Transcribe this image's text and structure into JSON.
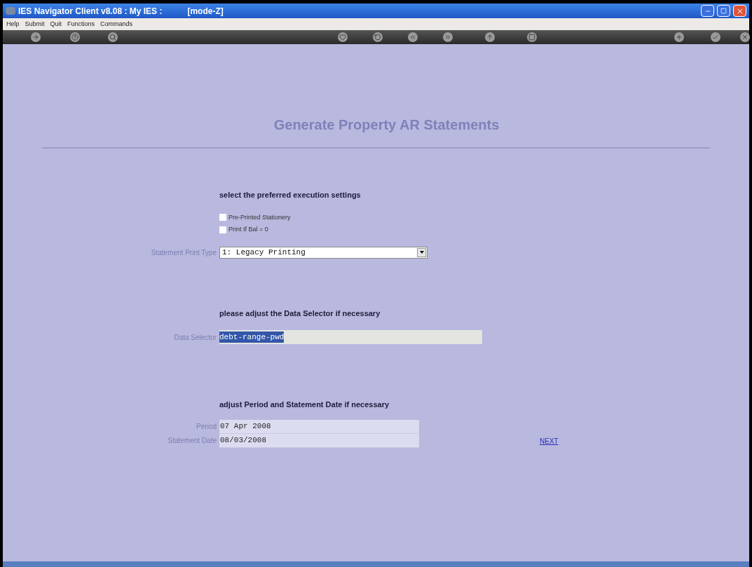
{
  "window": {
    "title": "IES Navigator Client v8.08 : My IES :",
    "mode": "[mode-Z]"
  },
  "menu": [
    "Help",
    "Submit",
    "Quit",
    "Functions",
    "Commands"
  ],
  "page": {
    "title": "Generate Property AR Statements"
  },
  "sections": [
    {
      "heading": "select the preferred execution settings"
    },
    {
      "heading": "please adjust the Data Selector if necessary"
    },
    {
      "heading": "adjust Period and Statement Date if necessary"
    }
  ],
  "options": [
    {
      "label": "Pre-Printed Stationery",
      "checked": false
    },
    {
      "label": "Print If Bal = 0",
      "checked": false
    }
  ],
  "print_type": {
    "label": "Statement Print Type",
    "value": "1: Legacy Printing"
  },
  "data_selector": {
    "label": "Data Selector",
    "value": "debt-range-pwd",
    "selected": true
  },
  "dates": [
    {
      "label": "Period",
      "value": "07 Apr 2008"
    },
    {
      "label": "Statement Date",
      "value": "08/03/2008"
    }
  ],
  "next_link": "NEXT"
}
